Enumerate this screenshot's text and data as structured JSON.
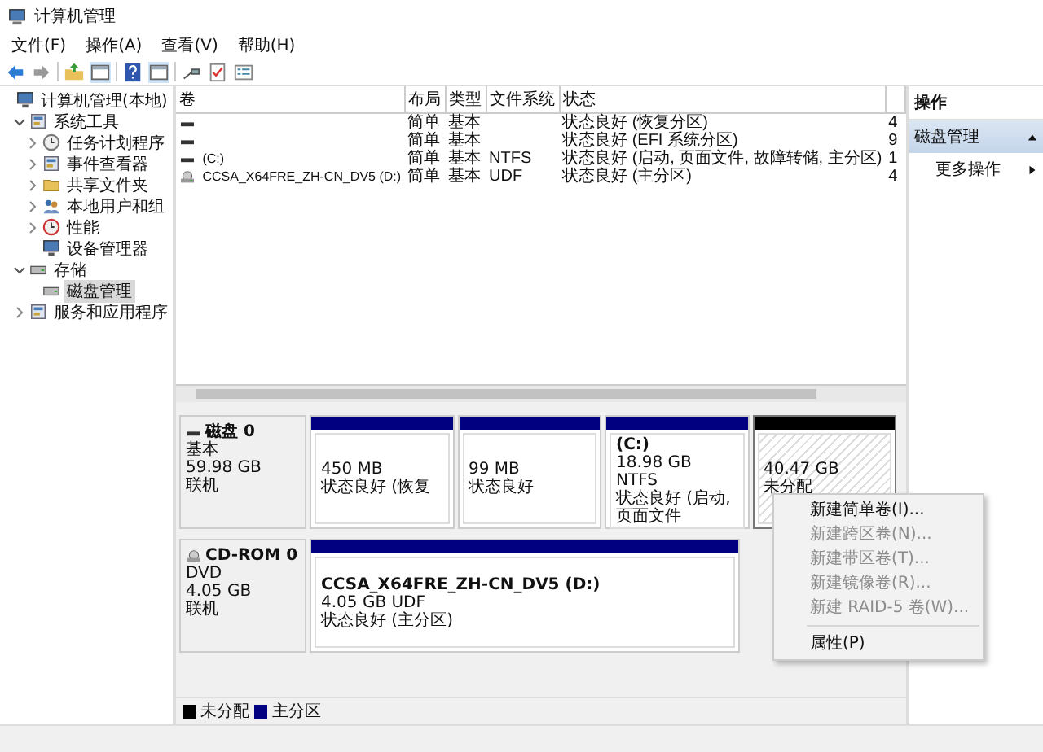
{
  "window": {
    "title": "计算机管理"
  },
  "menu_bar": [
    "文件(F)",
    "操作(A)",
    "查看(V)",
    "帮助(H)"
  ],
  "tree": [
    {
      "label": "计算机管理(本地)",
      "kind": "computer",
      "selected": false,
      "children": [
        {
          "label": "系统工具",
          "kind": "tools",
          "selected": false,
          "expanded": true,
          "children": [
            {
              "label": "任务计划程序",
              "kind": "clock",
              "selected": false,
              "expanded": false
            },
            {
              "label": "事件查看器",
              "kind": "log",
              "selected": false,
              "expanded": false
            },
            {
              "label": "共享文件夹",
              "kind": "folder",
              "selected": false,
              "expanded": false
            },
            {
              "label": "本地用户和组",
              "kind": "users",
              "selected": false,
              "expanded": false
            },
            {
              "label": "性能",
              "kind": "gauge",
              "selected": false,
              "expanded": false
            },
            {
              "label": "设备管理器",
              "kind": "devices",
              "selected": false
            }
          ]
        },
        {
          "label": "存储",
          "kind": "storage",
          "selected": false,
          "expanded": true,
          "children": [
            {
              "label": "磁盘管理",
              "kind": "drive",
              "selected": true
            }
          ]
        },
        {
          "label": "服务和应用程序",
          "kind": "services",
          "selected": false,
          "expanded": false
        }
      ]
    }
  ],
  "volume_table": {
    "columns": [
      "卷",
      "布局",
      "类型",
      "文件系统",
      "状态"
    ],
    "rows": [
      {
        "kind": "disk",
        "layout": "简单",
        "type": "基本",
        "status": "状态良好 (恢复分区)",
        "column_6": "4"
      },
      {
        "kind": "disk",
        "layout": "简单",
        "type": "基本",
        "status": "状态良好 (EFI 系统分区)",
        "column_6": "9"
      },
      {
        "kind": "disk",
        "volume": "(C:)",
        "layout": "简单",
        "type": "基本",
        "filesystem": "NTFS",
        "status": "状态良好 (启动, 页面文件, 故障转储, 主分区)",
        "column_6": "1"
      },
      {
        "kind": "cdrom",
        "volume": "CCSA_X64FRE_ZH-CN_DV5 (D:)",
        "layout": "简单",
        "type": "基本",
        "filesystem": "UDF",
        "status": "状态良好 (主分区)",
        "column_6": "4"
      }
    ]
  },
  "disks": [
    {
      "kind": "disk",
      "name": "磁盘 0",
      "type": "基本",
      "size": "59.98 GB",
      "status": "联机",
      "partitions": [
        {
          "kind": "primary",
          "selected": false,
          "size": "450 MB",
          "status": "状态良好 (恢复"
        },
        {
          "kind": "primary",
          "selected": false,
          "size": "99 MB",
          "status": "状态良好"
        },
        {
          "kind": "primary",
          "selected": false,
          "label": "(C:)",
          "size": "18.98 GB NTFS",
          "status": "状态良好 (启动, 页面文件"
        },
        {
          "kind": "unallocated",
          "selected": true,
          "size": "40.47 GB",
          "status": "未分配"
        }
      ]
    },
    {
      "kind": "cdrom",
      "name": "CD-ROM 0",
      "type": "DVD",
      "size": "4.05 GB",
      "status": "联机",
      "partitions": [
        {
          "kind": "primary",
          "selected": false,
          "label": "CCSA_X64FRE_ZH-CN_DV5  (D:)",
          "size": "4.05 GB UDF",
          "status": "状态良好 (主分区)"
        }
      ]
    }
  ],
  "legend": [
    {
      "label": "未分配",
      "color": "#000000"
    },
    {
      "label": "主分区",
      "color": "#000080"
    }
  ],
  "context_menu": [
    {
      "kind": "item",
      "label": "新建简单卷(I)...",
      "disabled": false
    },
    {
      "kind": "item",
      "label": "新建跨区卷(N)...",
      "disabled": true
    },
    {
      "kind": "item",
      "label": "新建带区卷(T)...",
      "disabled": true
    },
    {
      "kind": "item",
      "label": "新建镜像卷(R)...",
      "disabled": true
    },
    {
      "kind": "item",
      "label": "新建 RAID-5 卷(W)...",
      "disabled": true
    },
    {
      "kind": "separator"
    },
    {
      "kind": "item",
      "label": "属性(P)",
      "disabled": false
    }
  ],
  "actions": {
    "title": "操作",
    "group": {
      "label": "磁盘管理",
      "expanded": true
    },
    "items": [
      "更多操作"
    ]
  }
}
